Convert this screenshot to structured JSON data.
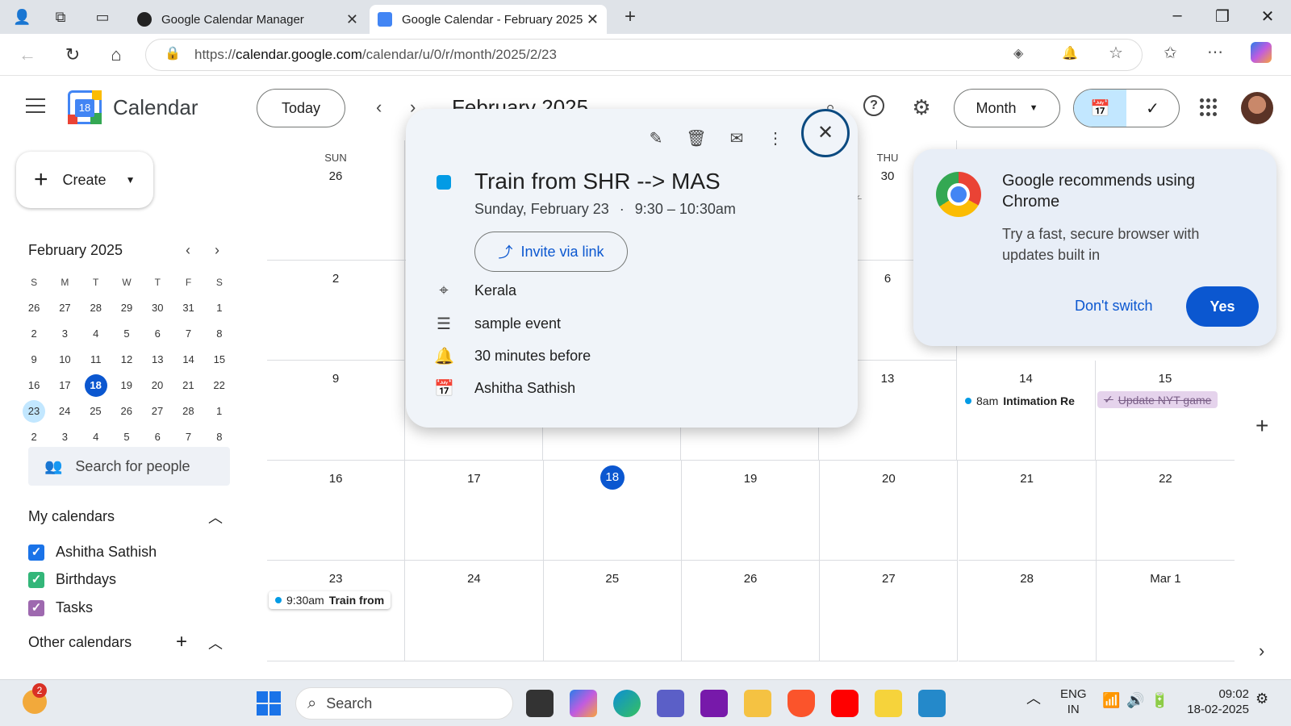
{
  "browser": {
    "tabs": [
      {
        "label": "Google Calendar Manager"
      },
      {
        "label": "Google Calendar - February 2025"
      }
    ],
    "url_prefix": "https://",
    "url_host": "calendar.google.com",
    "url_path": "/calendar/u/0/r/month/2025/2/23"
  },
  "header": {
    "app_name": "Calendar",
    "logo_day": "18",
    "today_label": "Today",
    "month_title": "February 2025",
    "view_label": "Month"
  },
  "sidebar": {
    "create_label": "Create",
    "mini_title": "February 2025",
    "weekday_heads": [
      "S",
      "M",
      "T",
      "W",
      "T",
      "F",
      "S"
    ],
    "weeks": [
      [
        "26",
        "27",
        "28",
        "29",
        "30",
        "31",
        "1"
      ],
      [
        "2",
        "3",
        "4",
        "5",
        "6",
        "7",
        "8"
      ],
      [
        "9",
        "10",
        "11",
        "12",
        "13",
        "14",
        "15"
      ],
      [
        "16",
        "17",
        "18",
        "19",
        "20",
        "21",
        "22"
      ],
      [
        "23",
        "24",
        "25",
        "26",
        "27",
        "28",
        "1"
      ],
      [
        "2",
        "3",
        "4",
        "5",
        "6",
        "7",
        "8"
      ]
    ],
    "today": "18",
    "selected": "23",
    "search_people": "Search for people",
    "my_calendars": "My calendars",
    "calendars": [
      {
        "label": "Ashitha Sathish",
        "color": "#1a73e8"
      },
      {
        "label": "Birthdays",
        "color": "#33b679"
      },
      {
        "label": "Tasks",
        "color": "#9e69af"
      }
    ],
    "other_calendars": "Other calendars"
  },
  "grid": {
    "sun_head": "SUN",
    "thu_head": "THU",
    "row1": {
      "sun": "26",
      "thu": "30"
    },
    "row2": {
      "sun": "2",
      "thu": "6"
    },
    "row3": {
      "sun": "9",
      "thu": "13",
      "fri": "14",
      "sat": "15"
    },
    "row4": [
      "16",
      "17",
      "18",
      "19",
      "20",
      "21",
      "22"
    ],
    "row5": [
      "23",
      "24",
      "25",
      "26",
      "27",
      "28",
      "Mar 1"
    ],
    "thu_partial": "30pm",
    "event_14_time": "8am",
    "event_14_title": "Intimation Re",
    "event_15_task": "Update NYT game",
    "event_23_time": "9:30am",
    "event_23_title": "Train from"
  },
  "popup": {
    "title": "Train from SHR --> MAS",
    "date": "Sunday, February 23",
    "time": "9:30 – 10:30am",
    "invite_label": "Invite via link",
    "location": "Kerala",
    "description": "sample event",
    "reminder": "30 minutes before",
    "organizer": "Ashitha Sathish",
    "event_color": "#039be5"
  },
  "promo": {
    "title": "Google recommends using Chrome",
    "body": "Try a fast, secure browser with updates built in",
    "dont_switch": "Don't switch",
    "yes": "Yes"
  },
  "taskbar": {
    "search": "Search",
    "notification_count": "2",
    "lang_top": "ENG",
    "lang_bottom": "IN",
    "time": "09:02",
    "date": "18-02-2025"
  }
}
